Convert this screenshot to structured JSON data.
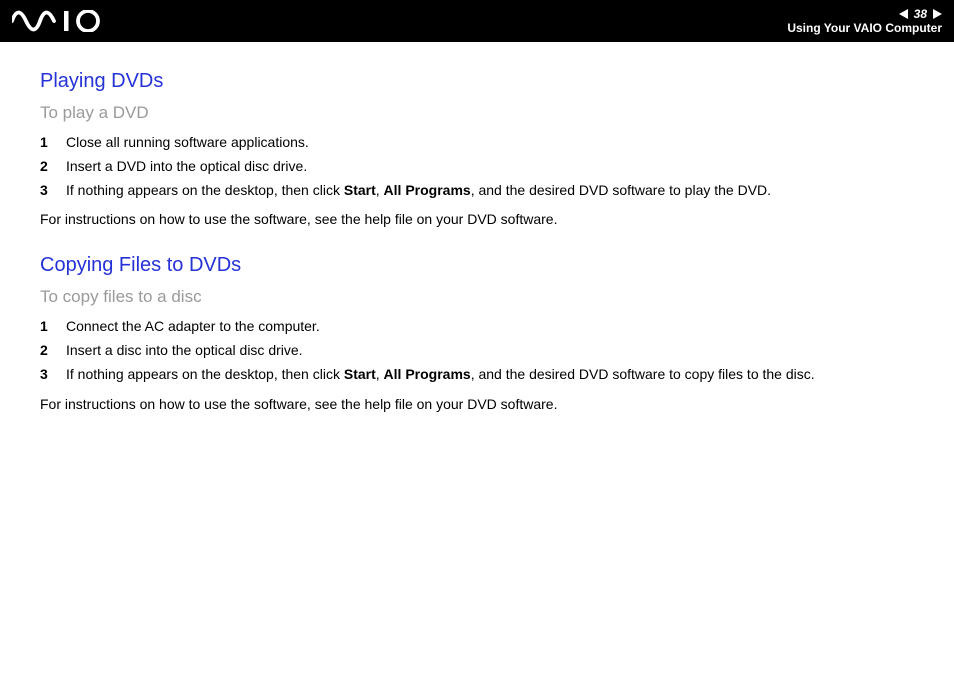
{
  "header": {
    "page_number": "38",
    "section": "Using Your VAIO Computer"
  },
  "section1": {
    "title": "Playing DVDs",
    "subtitle": "To play a DVD",
    "steps": {
      "n1": "1",
      "t1": "Close all running software applications.",
      "n2": "2",
      "t2": "Insert a DVD into the optical disc drive.",
      "n3": "3",
      "t3_a": "If nothing appears on the desktop, then click ",
      "t3_b": "Start",
      "t3_c": ", ",
      "t3_d": "All Programs",
      "t3_e": ", and the desired DVD software to play the DVD."
    },
    "note": "For instructions on how to use the software, see the help file on your DVD software."
  },
  "section2": {
    "title": "Copying Files to DVDs",
    "subtitle": "To copy files to a disc",
    "steps": {
      "n1": "1",
      "t1": "Connect the AC adapter to the computer.",
      "n2": "2",
      "t2": "Insert a disc into the optical disc drive.",
      "n3": "3",
      "t3_a": "If nothing appears on the desktop, then click ",
      "t3_b": "Start",
      "t3_c": ", ",
      "t3_d": "All Programs",
      "t3_e": ", and the desired DVD software to copy files to the disc."
    },
    "note": "For instructions on how to use the software, see the help file on your DVD software."
  }
}
